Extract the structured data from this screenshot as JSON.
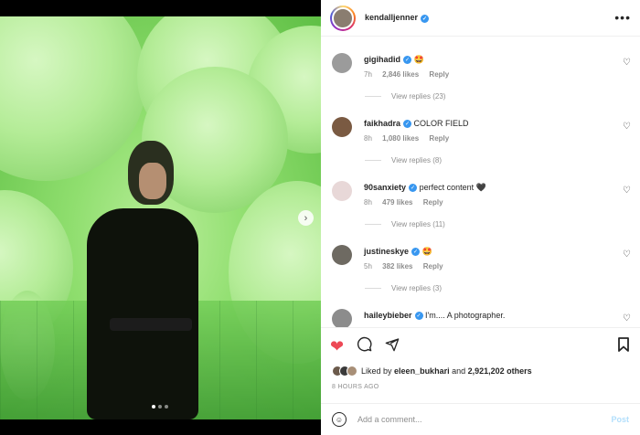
{
  "post": {
    "username": "kendalljenner",
    "more_icon": "more-horizontal-icon",
    "carousel": {
      "current": 1,
      "total": 3
    }
  },
  "comments": [
    {
      "user": "gigihadid",
      "text": "🤩",
      "time": "7h",
      "likes": "2,846 likes",
      "reply": "Reply",
      "view_replies": "View replies (23)",
      "avatar_color": "#9b9b9b"
    },
    {
      "user": "faikhadra",
      "text": "COLOR FIELD",
      "time": "8h",
      "likes": "1,080 likes",
      "reply": "Reply",
      "view_replies": "View replies (8)",
      "avatar_color": "#7a5a42"
    },
    {
      "user": "90sanxiety",
      "text": "perfect content 🖤",
      "time": "8h",
      "likes": "479 likes",
      "reply": "Reply",
      "view_replies": "View replies (11)",
      "avatar_color": "#e8d8d8"
    },
    {
      "user": "justineskye",
      "text": "🤩",
      "time": "5h",
      "likes": "382 likes",
      "reply": "Reply",
      "view_replies": "View replies (3)",
      "avatar_color": "#6e6a62"
    },
    {
      "user": "haileybieber",
      "text": "I'm.... A photographer.",
      "time": "",
      "likes": "",
      "reply": "",
      "view_replies": "",
      "avatar_color": "#8c8c8c"
    }
  ],
  "actions": {
    "liked": true,
    "like_icon": "heart-filled-icon",
    "comment_icon": "comment-icon",
    "share_icon": "share-icon",
    "save_icon": "bookmark-icon"
  },
  "likes_summary": {
    "prefix": "Liked by",
    "user": "eleen_bukhari",
    "middle": "and",
    "count": "2,921,202 others"
  },
  "timestamp": "8 HOURS AGO",
  "comment_box": {
    "placeholder": "Add a comment...",
    "post_label": "Post",
    "emoji_icon": "emoji-icon"
  },
  "colors": {
    "verified": "#3897f0",
    "like_red": "#ed4956",
    "post_disabled": "#b2dffc"
  }
}
